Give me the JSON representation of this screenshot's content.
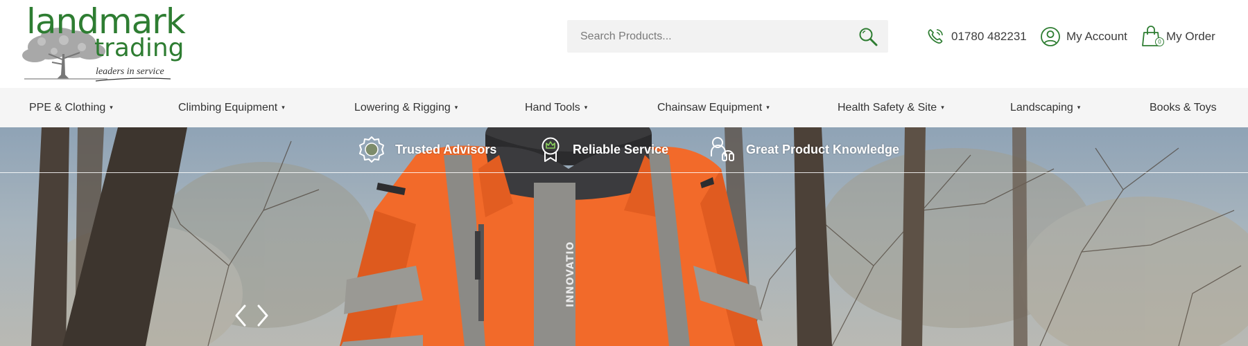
{
  "brand": {
    "name_line1": "landmark",
    "name_line2": "trading",
    "tagline": "leaders in service",
    "color": "#2e7d32"
  },
  "search": {
    "placeholder": "Search Products...",
    "icon": "search-icon"
  },
  "header_links": {
    "phone": {
      "icon": "phone-icon",
      "label": "01780 482231"
    },
    "account": {
      "icon": "user-icon",
      "label": "My Account"
    },
    "order": {
      "icon": "shopping-bag-icon",
      "label": "My Order",
      "count": "0"
    }
  },
  "nav": {
    "items": [
      {
        "label": "PPE & Clothing",
        "has_dropdown": true
      },
      {
        "label": "Climbing Equipment",
        "has_dropdown": true
      },
      {
        "label": "Lowering & Rigging",
        "has_dropdown": true
      },
      {
        "label": "Hand Tools",
        "has_dropdown": true
      },
      {
        "label": "Chainsaw Equipment",
        "has_dropdown": true
      },
      {
        "label": "Health Safety & Site",
        "has_dropdown": true
      },
      {
        "label": "Landscaping",
        "has_dropdown": true
      },
      {
        "label": "Books & Toys",
        "has_dropdown": false
      }
    ],
    "caret": "▾"
  },
  "usps": [
    {
      "icon": "rosette-icon",
      "label": "Trusted Advisors"
    },
    {
      "icon": "award-badge-icon",
      "label": "Reliable Service"
    },
    {
      "icon": "headset-icon",
      "label": "Great Product Knowledge"
    }
  ],
  "hero": {
    "jacket_brand": "INNOVATIO",
    "prev_icon": "chevron-left-icon",
    "next_icon": "chevron-right-icon"
  },
  "colors": {
    "accent_green": "#2e7d32",
    "nav_bg": "#f5f5f5",
    "search_bg": "#f2f2f2",
    "jacket_orange": "#f26a2a"
  }
}
